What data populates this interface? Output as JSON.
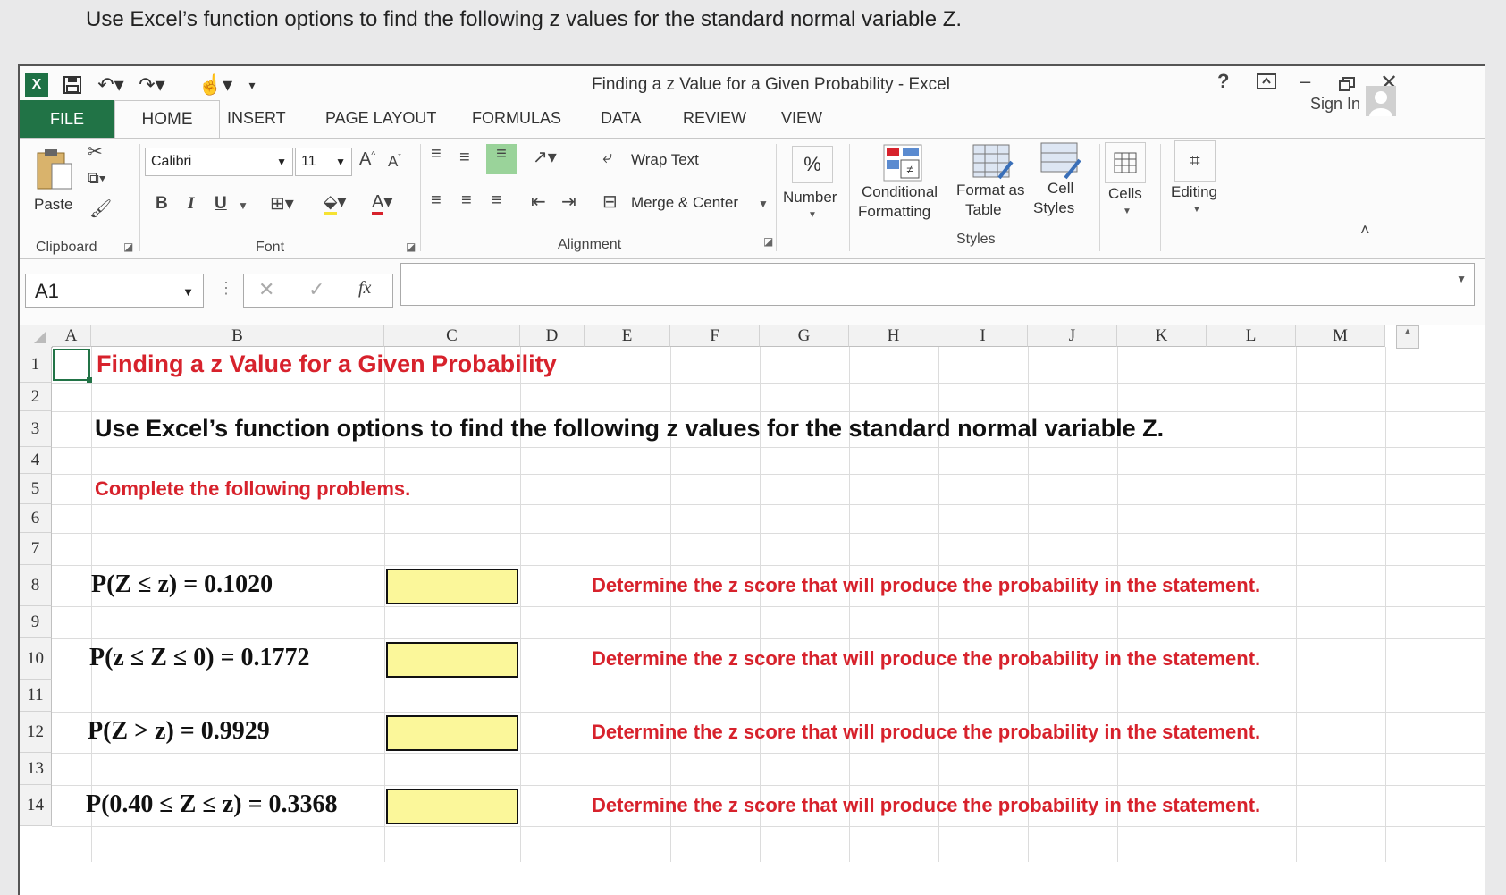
{
  "question": "Use Excel’s function options to find the following z values for the standard normal variable Z.",
  "window": {
    "title": "Finding a z Value for a Given Probability - Excel",
    "help": "?",
    "sign_in": "Sign In"
  },
  "tabs": [
    "FILE",
    "HOME",
    "INSERT",
    "PAGE LAYOUT",
    "FORMULAS",
    "DATA",
    "REVIEW",
    "VIEW"
  ],
  "ribbon": {
    "paste": "Paste",
    "clipboard": "Clipboard",
    "font_name": "Calibri",
    "font_size": "11",
    "bold": "B",
    "italic": "I",
    "underline": "U",
    "font": "Font",
    "wrap_text": "Wrap Text",
    "merge_center": "Merge & Center",
    "alignment": "Alignment",
    "percent": "%",
    "number": "Number",
    "conditional_1": "Conditional",
    "conditional_2": "Formatting",
    "format_table_1": "Format as",
    "format_table_2": "Table",
    "cell_styles_1": "Cell",
    "cell_styles_2": "Styles",
    "styles": "Styles",
    "cells": "Cells",
    "editing": "Editing"
  },
  "formula_bar": {
    "name_box": "A1",
    "fx": "fx"
  },
  "columns": [
    "A",
    "B",
    "C",
    "D",
    "E",
    "F",
    "G",
    "H",
    "I",
    "J",
    "K",
    "L",
    "M"
  ],
  "rows": [
    "1",
    "2",
    "3",
    "4",
    "5",
    "6",
    "7",
    "8",
    "9",
    "10",
    "11",
    "12",
    "13",
    "14"
  ],
  "sheet": {
    "title": "Finding a z Value for a Given Probability",
    "subtitle": "Use Excel’s function options to find the following z values for the standard normal variable Z.",
    "instructions": "Complete the following problems.",
    "problems": [
      {
        "statement": "P(Z ≤ z) = 0.1020",
        "note": "Determine the z score that will produce the probability in the statement."
      },
      {
        "statement": "P(z ≤ Z ≤ 0) = 0.1772",
        "note": "Determine the z score that will produce the probability in the statement."
      },
      {
        "statement": "P(Z > z) = 0.9929",
        "note": "Determine the z score that will produce the probability in the statement."
      },
      {
        "statement": "P(0.40 ≤ Z ≤ z) = 0.3368",
        "note": "Determine the z score that will produce the probability in the statement."
      }
    ]
  }
}
